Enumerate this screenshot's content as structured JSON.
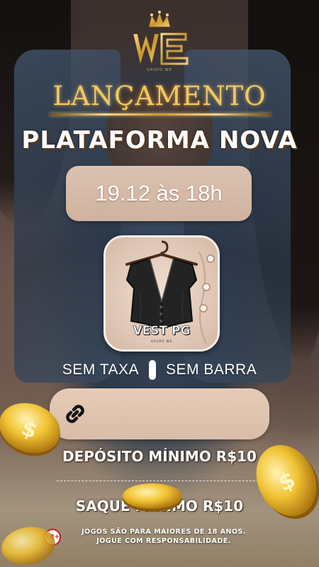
{
  "brand": {
    "logo_text": "WE",
    "logo_sub": "GRUPO WE"
  },
  "headline": "LANÇAMENTO",
  "subheadline": "PLATAFORMA NOVA",
  "launch_date": "19.12 às 18h",
  "app": {
    "name": "VEST PG",
    "sub": "GRUPO WE"
  },
  "tags": {
    "left": "SEM TAXA",
    "right": "SEM BARRA"
  },
  "link_icon": "link-chain-icon",
  "deposit": "DEPÓSITO MÍNIMO R$10",
  "withdraw": "SAQUE MÍNIMO R$10",
  "age_badge": "18+",
  "disclaimer_line1": "JOGOS SÃO PARA MAIORES DE 18 ANOS.",
  "disclaimer_line2": "JOGUE COM RESPONSABILIDADE.",
  "colors": {
    "gold": "#f0c866",
    "beige_panel": "#dcc2b2",
    "white": "#ffffff",
    "age_red": "#c81e1e"
  }
}
